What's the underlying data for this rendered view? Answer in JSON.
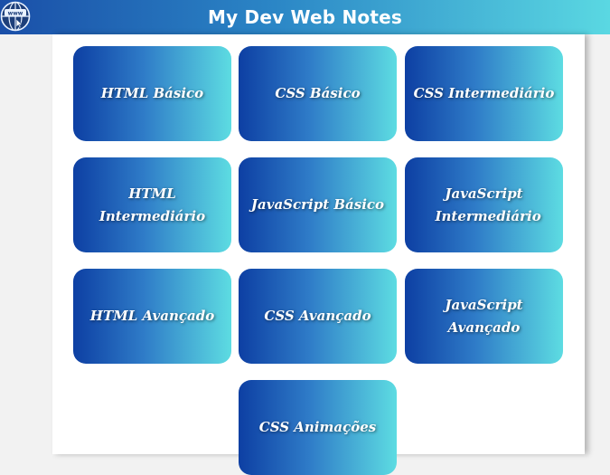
{
  "header": {
    "title": "My Dev Web Notes",
    "logo_icon": "globe-www-icon"
  },
  "cards": [
    {
      "label": "HTML Básico"
    },
    {
      "label": "CSS Básico"
    },
    {
      "label": "CSS Intermediário"
    },
    {
      "label": "HTML Intermediário"
    },
    {
      "label": "JavaScript Básico"
    },
    {
      "label": "JavaScript Intermediário"
    },
    {
      "label": "HTML Avançado"
    },
    {
      "label": "CSS Avançado"
    },
    {
      "label": "JavaScript Avançado"
    },
    {
      "label": "CSS Animações"
    }
  ],
  "colors": {
    "header_start": "#1a4fa8",
    "header_end": "#5ad8e2",
    "card_start": "#0d3fa3",
    "card_end": "#5ddce2",
    "text": "#ffffff"
  }
}
